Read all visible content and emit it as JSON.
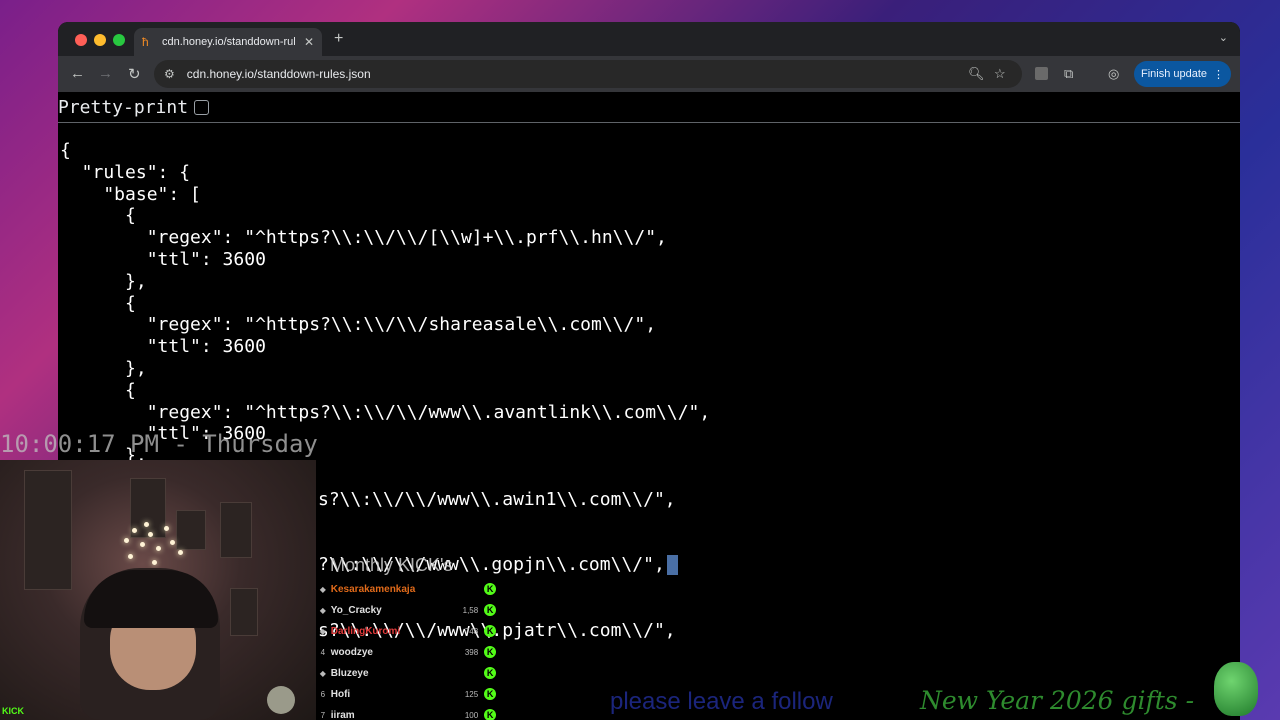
{
  "browser": {
    "tab_title": "cdn.honey.io/standdown-rule",
    "url": "cdn.honey.io/standdown-rules.json",
    "finish_update_label": "Finish update",
    "pretty_print_label": "Pretty-print"
  },
  "json_lines": [
    "{",
    "  \"rules\": {",
    "    \"base\": [",
    "      {",
    "        \"regex\": \"^https?\\\\:\\\\/\\\\/[\\\\w]+\\\\.prf\\\\.hn\\\\/\",",
    "        \"ttl\": 3600",
    "      },",
    "      {",
    "        \"regex\": \"^https?\\\\:\\\\/\\\\/shareasale\\\\.com\\\\/\",",
    "        \"ttl\": 3600",
    "      },",
    "      {",
    "        \"regex\": \"^https?\\\\:\\\\/\\\\/www\\\\.avantlink\\\\.com\\\\/\",",
    "        \"ttl\": 3600",
    "      },",
    "",
    "s?\\\\:\\\\/\\\\/www\\\\.awin1\\\\.com\\\\/\",",
    "",
    "",
    "?\\\\:\\\\/\\\\/www\\\\.gopjn\\\\.com\\\\/\",",
    "",
    "",
    "s?\\\\:\\\\/\\\\/www\\\\.pjatr\\\\.com\\\\/\","
  ],
  "overlay": {
    "clock": "10:00:17 PM - Thursday",
    "leaderboard_title": "Monthly KICK's",
    "leaderboard": [
      {
        "rank": "",
        "name": "Kesarakamenkaja",
        "points": "",
        "color": "#e06a1a"
      },
      {
        "rank": "",
        "name": "Yo_Cracky",
        "points": "1,58",
        "color": "#e0e0e0"
      },
      {
        "rank": "",
        "name": "DarlingKuromi",
        "points": "748",
        "color": "#e23b3b"
      },
      {
        "rank": "4",
        "name": "woodzye",
        "points": "398",
        "color": "#e0e0e0"
      },
      {
        "rank": "",
        "name": "Bluzeye",
        "points": "",
        "color": "#e0e0e0"
      },
      {
        "rank": "6",
        "name": "Hofi",
        "points": "125",
        "color": "#e0e0e0"
      },
      {
        "rank": "7",
        "name": "iiram",
        "points": "100",
        "color": "#e0e0e0"
      }
    ],
    "kick_badge": "KICK",
    "follow_ticker": "please leave a follow",
    "gifts_ticker": "New Year 2026 gifts -"
  }
}
